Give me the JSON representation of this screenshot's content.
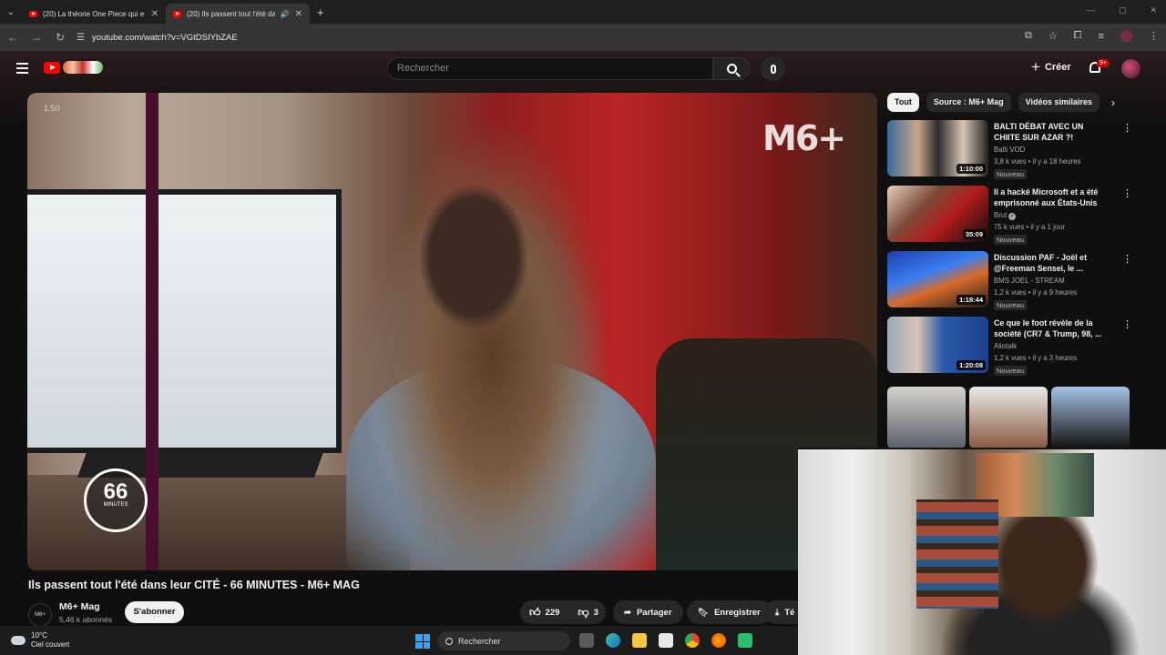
{
  "browser": {
    "tabs": [
      {
        "title": "(20) La théorie One Piece qui e",
        "active": false
      },
      {
        "title": "(20) Ils passent tout l'été da",
        "active": true
      }
    ],
    "new_tab": "+",
    "url": "youtube.com/watch?v=VGtDSIYbZAE"
  },
  "header": {
    "search_placeholder": "Rechercher",
    "create_label": "Créer",
    "notifications_badge": "9+"
  },
  "video": {
    "title": "Ils passent tout l'été dans leur CITÉ - 66 MINUTES - M6+ MAG",
    "overlay_logo": "M6+",
    "badge_number": "66",
    "badge_label": "MINUTES",
    "timestamp_overlay": "1:50",
    "channel_name": "M6+ Mag",
    "channel_avatar_text": "M6+ MAG",
    "subscribers": "5,46 k abonnés",
    "subscribe_label": "S'abonner",
    "likes": "229",
    "dislikes": "3",
    "share_label": "Partager",
    "save_label": "Enregistrer",
    "download_label": "Té"
  },
  "sidebar": {
    "chips": [
      "Tout",
      "Source : M6+ Mag",
      "Vidéos similaires"
    ],
    "recommendations": [
      {
        "title": "BALTI DÉBAT AVEC UN CHIITE SUR AZAR ?!",
        "channel": "Balti VOD",
        "meta": "3,8 k vues • il y a 18 heures",
        "duration": "1:10:00",
        "badge": "Nouveau",
        "verified": false
      },
      {
        "title": "Il a hacké Microsoft et a été emprisonné aux États-Unis",
        "channel": "Brut",
        "meta": "75 k vues • il y a 1 jour",
        "duration": "35:09",
        "badge": "Nouveau",
        "verified": true
      },
      {
        "title": "Discussion PAF - Joël et @Freeman Sensei, le ...",
        "channel": "BMS JOEL - STREAM",
        "meta": "1,2 k vues • il y a 9 heures",
        "duration": "1:18:44",
        "badge": "Nouveau",
        "verified": false
      },
      {
        "title": "Ce que le foot révèle de la société (CR7 & Trump, 98, ...",
        "channel": "Aliotalk",
        "meta": "1,2 k vues • il y a 3 heures",
        "duration": "1:20:08",
        "badge": "Nouveau",
        "verified": false
      }
    ]
  },
  "taskbar": {
    "temperature": "10°C",
    "weather": "Ciel couvert",
    "search_label": "Rechercher"
  },
  "colors": {
    "youtube_red": "#ff0000",
    "background": "#0f0f0f",
    "chip_bg": "#272727"
  }
}
